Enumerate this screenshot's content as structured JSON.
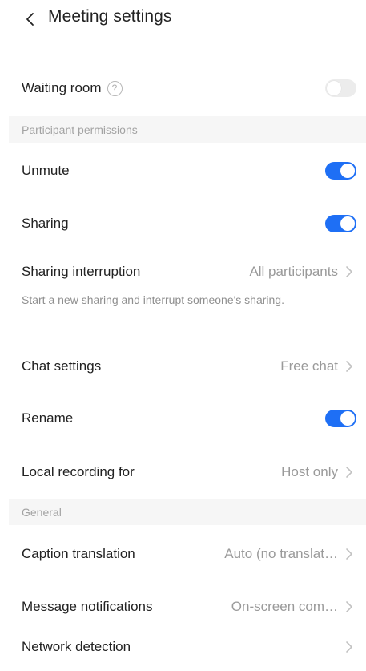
{
  "header": {
    "title": "Meeting settings",
    "back_icon": "chevron-left-icon"
  },
  "waiting_room": {
    "label": "Waiting room",
    "help_glyph": "?",
    "enabled": false
  },
  "sections": {
    "participant_permissions": "Participant permissions",
    "general": "General"
  },
  "unmute": {
    "label": "Unmute",
    "enabled": true
  },
  "sharing": {
    "label": "Sharing",
    "enabled": true
  },
  "sharing_interruption": {
    "label": "Sharing interruption",
    "value": "All participants",
    "description": "Start a new sharing and interrupt someone's sharing."
  },
  "chat_settings": {
    "label": "Chat settings",
    "value": "Free chat"
  },
  "rename": {
    "label": "Rename",
    "enabled": true
  },
  "local_recording": {
    "label": "Local recording for",
    "value": "Host only"
  },
  "caption_translation": {
    "label": "Caption translation",
    "value": "Auto (no translat…"
  },
  "message_notifications": {
    "label": "Message notifications",
    "value": "On-screen com…"
  },
  "network_detection": {
    "label": "Network detection"
  },
  "colors": {
    "toggle_on": "#1e6ff5",
    "toggle_off": "#ececec",
    "section_bg": "#f6f6f6"
  }
}
